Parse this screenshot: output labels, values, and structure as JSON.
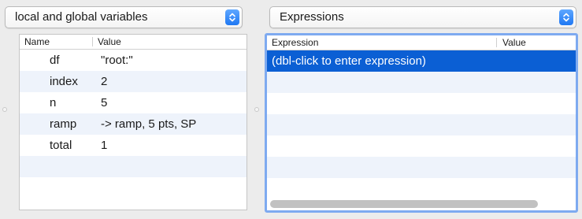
{
  "left_panel": {
    "popup_label": "local and global variables",
    "headers": {
      "name": "Name",
      "value": "Value"
    },
    "rows": [
      {
        "name": "df",
        "value": "\"root:\""
      },
      {
        "name": "index",
        "value": "2"
      },
      {
        "name": "n",
        "value": "5"
      },
      {
        "name": "ramp",
        "value": "-> ramp, 5 pts, SP"
      },
      {
        "name": "total",
        "value": "1"
      }
    ]
  },
  "right_panel": {
    "popup_label": "Expressions",
    "headers": {
      "expression": "Expression",
      "value": "Value"
    },
    "rows": [
      {
        "expression": "(dbl-click to enter expression)",
        "value": ""
      }
    ]
  },
  "colors": {
    "selection": "#0b5fd4",
    "accent": "#1f78f3",
    "alt_row": "#eef3fb",
    "focus_ring": "#7eaaf0"
  }
}
